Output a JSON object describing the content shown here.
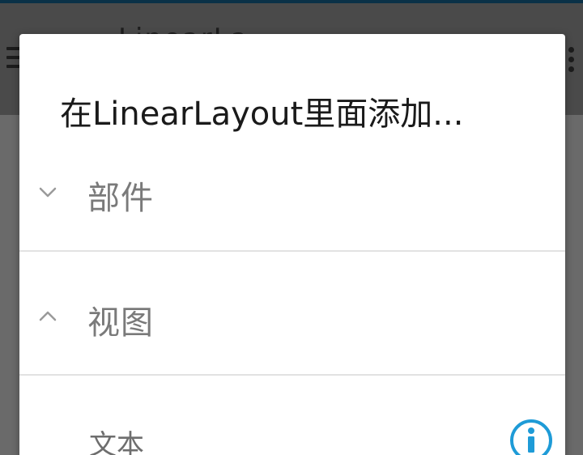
{
  "background_app": {
    "title": "LinearLa"
  },
  "dialog": {
    "title": "在LinearLayout里面添加...",
    "groups": [
      {
        "label": "部件",
        "state": "collapsed",
        "icon": "chevron-down-icon"
      },
      {
        "label": "视图",
        "state": "expanded",
        "icon": "chevron-up-icon"
      }
    ],
    "items": [
      {
        "label": "文本",
        "icon": "info-icon"
      }
    ]
  },
  "colors": {
    "accent": "#1e9bd7",
    "dialog_bg": "#ffffff",
    "title_text": "#1a1a1a",
    "secondary_text": "#7a7a7a"
  }
}
